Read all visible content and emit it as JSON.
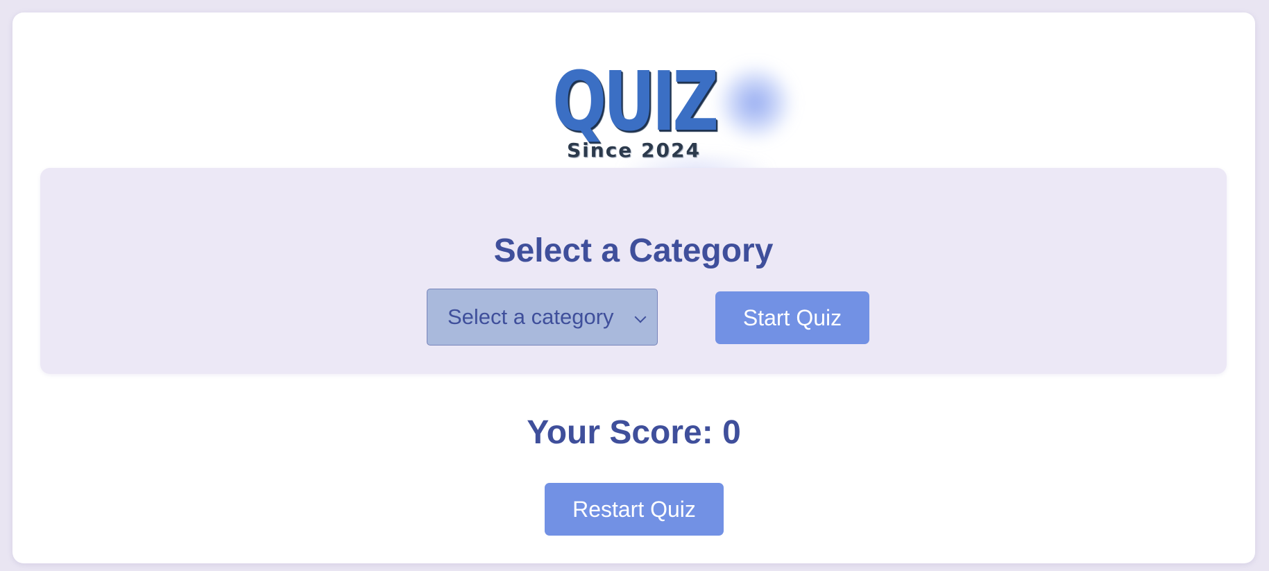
{
  "logo": {
    "word": "QUIZ",
    "tagline": "Since 2024"
  },
  "category_section": {
    "title": "Select a Category",
    "select": {
      "selected_label": "Select a category"
    },
    "start_button_label": "Start Quiz"
  },
  "score": {
    "text": "Your Score: 0"
  },
  "restart_button_label": "Restart Quiz",
  "colors": {
    "page_background": "#e9e5f2",
    "card_background": "#ffffff",
    "panel_background": "#ece8f6",
    "heading_text": "#3f4f9b",
    "button_background": "#7291e4",
    "select_background": "#a9b9dc",
    "logo_blue": "#3b6fc4"
  }
}
